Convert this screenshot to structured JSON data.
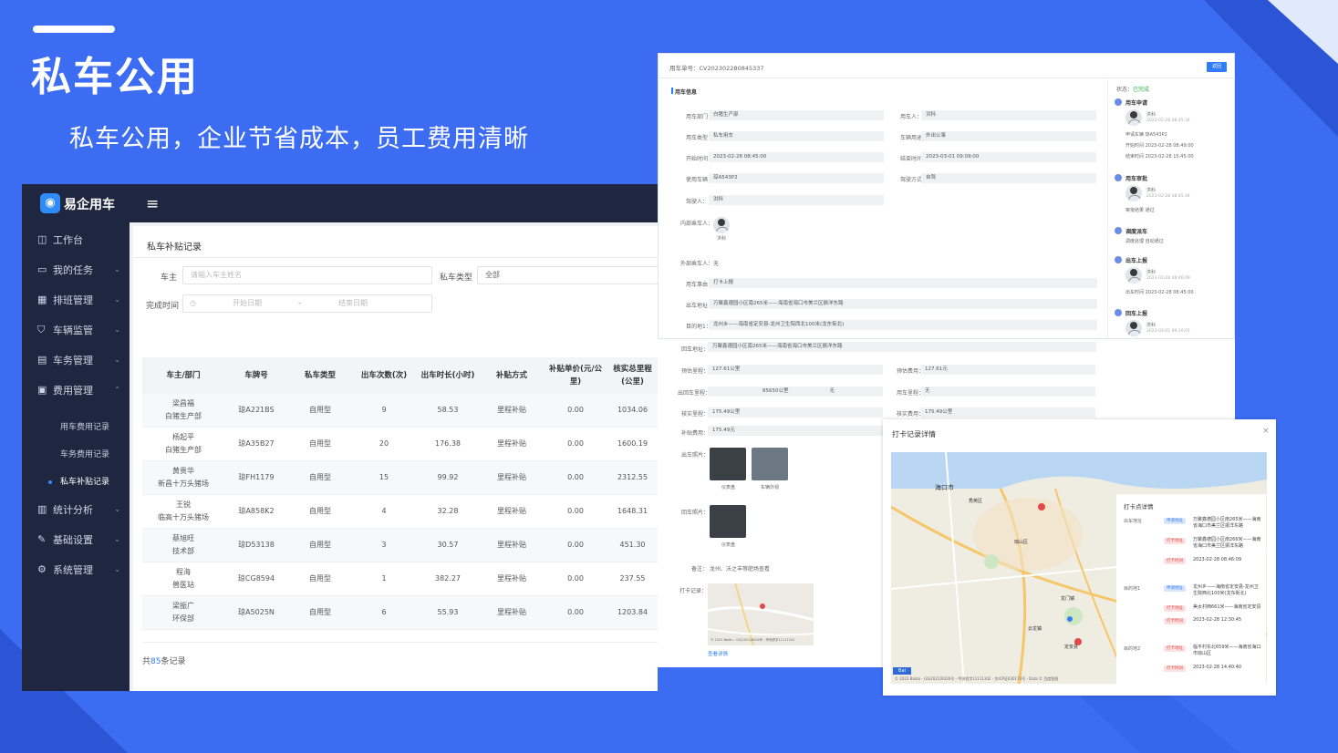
{
  "hero": {
    "title": "私车公用",
    "subtitle": "私车公用，企业节省成本，员工费用清晰"
  },
  "app": {
    "name": "易企用车",
    "sidebar": [
      {
        "label": "工作台",
        "icon": "dashboard-icon"
      },
      {
        "label": "我的任务",
        "icon": "task-icon"
      },
      {
        "label": "排班管理",
        "icon": "schedule-icon"
      },
      {
        "label": "车辆监管",
        "icon": "shield-icon"
      },
      {
        "label": "车务管理",
        "icon": "document-icon"
      },
      {
        "label": "费用管理",
        "icon": "cost-icon"
      },
      {
        "label": "统计分析",
        "icon": "chart-icon"
      },
      {
        "label": "基础设置",
        "icon": "wrench-icon"
      },
      {
        "label": "系统管理",
        "icon": "gear-icon"
      }
    ],
    "sub_items": [
      "用车费用记录",
      "车务费用记录",
      "私车补贴记录"
    ],
    "panel_title": "私车补贴记录",
    "filters": {
      "owner_label": "车主",
      "owner_placeholder": "请输入车主姓名",
      "type_label": "私车类型",
      "type_value": "全部",
      "time_label": "完成时间",
      "start_placeholder": "开始日期",
      "dash": "-",
      "end_placeholder": "结束日期"
    },
    "table": {
      "headers": [
        "车主/部门",
        "车牌号",
        "私车类型",
        "出车次数(次)",
        "出车时长(小时)",
        "补贴方式",
        "补贴单价(元/公里)",
        "核实总里程(公里)"
      ],
      "rows": [
        [
          "梁昌福",
          "白猪生产部",
          "琼A221BS",
          "自用型",
          "9",
          "58.53",
          "里程补贴",
          "0.00",
          "1034.06"
        ],
        [
          "杨起平",
          "白猪生产部",
          "琼A35B27",
          "自用型",
          "20",
          "176.38",
          "里程补贴",
          "0.00",
          "1600.19"
        ],
        [
          "黄贵华",
          "新昌十万头猪场",
          "琼FH1179",
          "自用型",
          "15",
          "99.92",
          "里程补贴",
          "0.00",
          "2312.55"
        ],
        [
          "王锐",
          "临高十万头猪场",
          "琼A858K2",
          "自用型",
          "4",
          "32.28",
          "里程补贴",
          "0.00",
          "1648.31"
        ],
        [
          "蔡旭旺",
          "技术部",
          "琼D53138",
          "自用型",
          "3",
          "30.57",
          "里程补贴",
          "0.00",
          "451.30"
        ],
        [
          "程海",
          "兽医站",
          "琼CG8594",
          "自用型",
          "1",
          "382.27",
          "里程补贴",
          "0.00",
          "237.55"
        ],
        [
          "梁振广",
          "环保部",
          "琼A5025N",
          "自用型",
          "6",
          "55.93",
          "里程补贴",
          "0.00",
          "1203.84"
        ]
      ],
      "total_prefix": "共",
      "total_count": "85",
      "total_suffix": "条记录"
    }
  },
  "detail": {
    "order_label": "用车单号：CV202302280845337",
    "button": "返回",
    "section": "用车信息",
    "fields": [
      [
        "用车部门：",
        "白猪生产部",
        "用车人：",
        "洪科"
      ],
      [
        "用车类型：",
        "私车用车",
        "车辆用途：",
        "外出公事"
      ],
      [
        "开始时间：",
        "2023-02-28 08:45:00",
        "结束时间：",
        "2023-03-01 09:09:00"
      ],
      [
        "使用车辆：",
        "琼A543P2",
        "驾驶方式：",
        "自驾"
      ]
    ],
    "driver_label": "驾驶人：",
    "driver": "洪科",
    "inner_label": "内部乘车人：",
    "inner_name": "洪科",
    "outer_label": "外部乘车人：",
    "outer_value": "无",
    "reason_label": "用车事由：",
    "reason": "打卡上报",
    "from_label": "出车地址：",
    "from": "万聚鑫德园小区南265米——海南省海口市美兰区振洋东路",
    "to_label": "目的地1：",
    "to": "龙州乡——海南省定安县-龙州卫生院西北100米(龙东街北)",
    "return_label": "回车地址：",
    "return": "万聚鑫德园小区南265米——海南省海口市美兰区振洋东路",
    "fields2": [
      [
        "预估里程：",
        "127.61公里",
        "预估费用：",
        "127.61元"
      ],
      [
        "出回车里程：",
        "85650公里",
        "无",
        "用车里程：",
        "无"
      ],
      [
        "核实里程：",
        "175.49公里",
        "核实费用：",
        "175.49公里"
      ]
    ],
    "subsidy_label": "补贴费用：",
    "subsidy": "175.49元",
    "out_photo_label": "出车照片：",
    "photo1": "仪表盘",
    "photo2": "车辆外观",
    "back_photo_label": "回车照片：",
    "photo3": "仪表盘",
    "note_label": "备注：",
    "note": "龙州、沃之丰等肥场查看",
    "checkin_label": "打卡记录：",
    "view_detail": "查看详情",
    "status_label": "状态：",
    "status": "已完成",
    "timeline": [
      {
        "title": "用车申请",
        "name": "洪科",
        "time": "2023-02-28 08:45:34",
        "lines": [
          "申请车辆  琼A543P2",
          "开始时间  2023-02-28 08:49:00",
          "结束时间  2023-02-28 15:45:00"
        ]
      },
      {
        "title": "用车审批",
        "name": "洪科",
        "time": "2023-02-28 08:45:44",
        "lines": [
          "审批结果  通过"
        ]
      },
      {
        "title": "调度派车",
        "name": "",
        "time": "",
        "lines": [
          "调度处理  自动通过"
        ]
      },
      {
        "title": "出车上报",
        "name": "洪科",
        "time": "2023-02-28 08:46:09",
        "lines": [
          "出车时间  2023-02-28 08:45:00"
        ]
      },
      {
        "title": "回车上报",
        "name": "洪科",
        "time": "2023-03-01 09:10:01",
        "lines": [
          "出车时间  2023-02-28 08:45:00",
          "回车时间  2023-03-01 09:09:00"
        ]
      },
      {
        "title": "回车审批",
        "name": "詹海媛",
        "time": "2023-03-01 10:01:38",
        "lines": [
          "审批结果  通过"
        ]
      }
    ]
  },
  "popup": {
    "title": "打卡记录详情",
    "close": "×",
    "info_title": "打卡点详情",
    "groups": [
      {
        "label": "出车地址",
        "entries": [
          [
            "申请地址",
            "万聚鑫德园小区南265米——海南省海口市美兰区振洋东路"
          ],
          [
            "打卡地址",
            "万聚鑫德园小区南266米——海南省海口市美兰区振洋东路"
          ],
          [
            "打卡时间",
            "2023-02-28 08:46:09"
          ]
        ]
      },
      {
        "label": "目的地1",
        "entries": [
          [
            "申请地址",
            "龙州乡——海南省定安县-龙州卫生院西北100米(龙东街北)"
          ],
          [
            "打卡地址",
            "美太村西661米——海南省定安县"
          ],
          [
            "打卡时间",
            "2023-02-28 12:30:45"
          ]
        ]
      },
      {
        "label": "目的地2",
        "entries": [
          [
            "打卡地址",
            "临平村东北659米——海南省海口市琼山区"
          ],
          [
            "打卡时间",
            "2023-02-28 14:40:40"
          ]
        ]
      },
      {
        "label": "回车地址",
        "entries": [
          [
            "申请地址",
            "万聚鑫德园小区南265米——海南省海口市美兰区振洋东路"
          ]
        ]
      }
    ],
    "map_labels": [
      "海口市",
      "秀英区",
      "琼山区",
      "定安县",
      "云龙镇",
      "龙门镇"
    ],
    "map_footer": "© 2023 Baidu - GS(2021)6026号 - 甲测资字11111342 - 京ICP证030173号 - Data © 百度智图",
    "mini_footer": "© 2023 Baidu - GS(2021)6026号 - 甲测资字11111342"
  },
  "colors": {
    "background": "#3b6cf2",
    "sidebar": "#1f2740",
    "accent": "#2f7cf6",
    "success": "#2db34a"
  }
}
